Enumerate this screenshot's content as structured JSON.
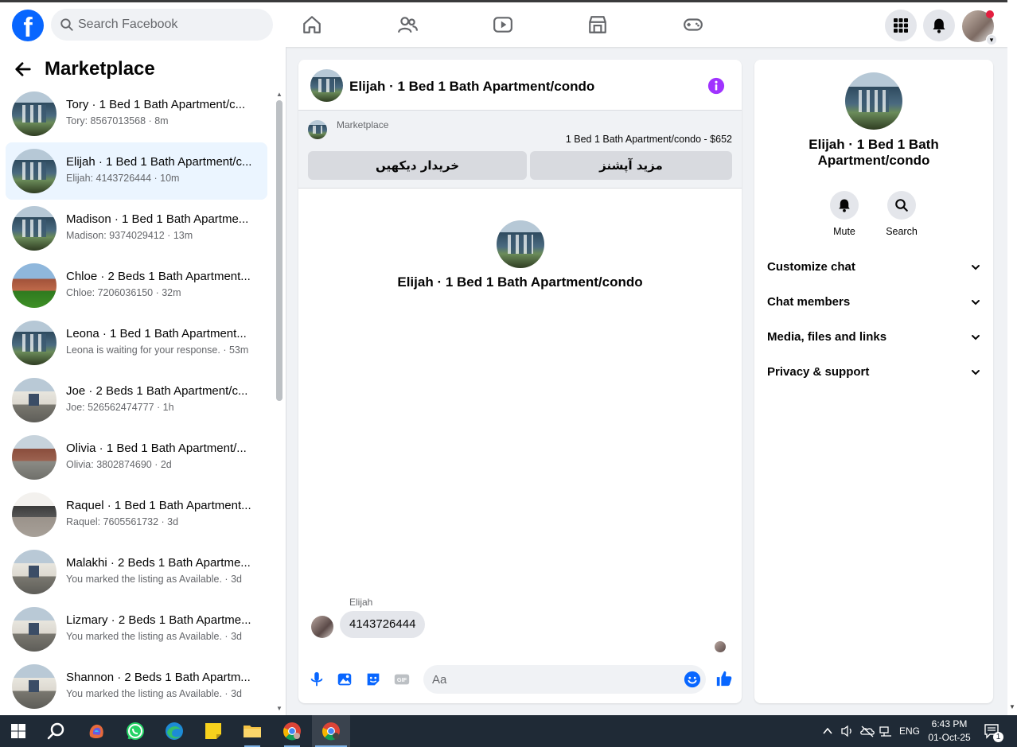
{
  "topnav": {
    "search_placeholder": "Search Facebook",
    "logo_letter": "f",
    "brand_color": "#0866ff"
  },
  "left": {
    "title": "Marketplace",
    "conversations": [
      {
        "title": "Tory · 1 Bed 1 Bath Apartment/c...",
        "subtitle": "Tory: 8567013568 · 8m",
        "thumb": "house"
      },
      {
        "title": "Elijah · 1 Bed 1 Bath Apartment/c...",
        "subtitle": "Elijah: 4143726444 · 10m",
        "thumb": "house",
        "active": true
      },
      {
        "title": "Madison · 1 Bed 1 Bath Apartme...",
        "subtitle": "Madison: 9374029412 · 13m",
        "thumb": "house"
      },
      {
        "title": "Chloe · 2 Beds 1 Bath Apartment...",
        "subtitle": "Chloe: 7206036150 · 32m",
        "thumb": "brick"
      },
      {
        "title": "Leona  · 1 Bed 1 Bath Apartment...",
        "subtitle": "Leona is waiting for your response. · 53m",
        "thumb": "house"
      },
      {
        "title": "Joe · 2 Beds 1 Bath Apartment/c...",
        "subtitle": "Joe: 526562474777 · 1h",
        "thumb": "white"
      },
      {
        "title": "Olivia · 1 Bed 1 Bath Apartment/...",
        "subtitle": "Olivia: 3802874690 · 2d",
        "thumb": "olivia"
      },
      {
        "title": "Raquel · 1 Bed 1 Bath Apartment...",
        "subtitle": "Raquel: 7605561732 · 3d",
        "thumb": "kitchen"
      },
      {
        "title": "Malakhi · 2 Beds 1 Bath Apartme...",
        "subtitle": "You marked the listing as Available. · 3d",
        "thumb": "white"
      },
      {
        "title": "Lizmary · 2 Beds 1 Bath Apartme...",
        "subtitle": "You marked the listing as Available. · 3d",
        "thumb": "white"
      },
      {
        "title": "Shannon · 2 Beds 1 Bath Apartm...",
        "subtitle": "You marked the listing as Available. · 3d",
        "thumb": "white"
      }
    ]
  },
  "chat": {
    "header_title": "Elijah · 1 Bed 1 Bath Apartment/condo",
    "marketplace_label": "Marketplace",
    "listing": "1 Bed 1 Bath Apartment/condo - $652",
    "btn_buyer": "خریدار دیکھیں",
    "btn_more": "مزید آپشنز",
    "center_name": "Elijah · 1 Bed 1 Bath Apartment/condo",
    "message_sender": "Elijah",
    "message_text": "4143726444",
    "composer_placeholder": "Aa",
    "accent_color": "#0866ff",
    "info_color": "#a033ff"
  },
  "right": {
    "name": "Elijah · 1 Bed 1 Bath Apartment/condo",
    "mute_label": "Mute",
    "search_label": "Search",
    "sections": [
      "Customize chat",
      "Chat members",
      "Media, files and links",
      "Privacy & support"
    ]
  },
  "taskbar": {
    "lang": "ENG",
    "time": "6:43 PM",
    "date": "01-Oct-25",
    "notification_count": "1"
  }
}
